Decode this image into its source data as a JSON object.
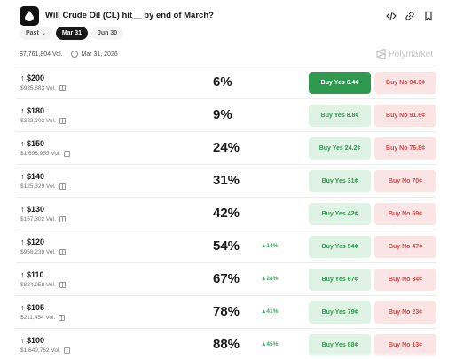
{
  "header": {
    "title": "Will Crude Oil (CL) hit__ by end of March?",
    "icons": [
      "drop-icon",
      "code-icon",
      "link-icon",
      "bookmark-icon"
    ]
  },
  "tabs": [
    {
      "label": "Past",
      "active": false,
      "has_caret": true
    },
    {
      "label": "Mar 31",
      "active": true
    },
    {
      "label": "Jun 30",
      "active": false
    }
  ],
  "meta": {
    "volume": "$7,761,804 Vol.",
    "date": "Mar 31, 2026"
  },
  "brand": "Polymarket",
  "colors": {
    "yes_bg": "#dff3e5",
    "yes_text": "#2f9a4f",
    "yes_solid": "#2f9a4f",
    "no_bg": "#fbe4e4",
    "no_text": "#d24a4a",
    "change_up": "#3bab5f"
  },
  "markets": [
    {
      "price": "↑ $200",
      "volume": "$935,883 Vol.",
      "percent": "6%",
      "change": "",
      "buy_yes": "Buy Yes 6.4¢",
      "buy_no": "Buy No 94.0¢",
      "yes_highlighted": true
    },
    {
      "price": "↑ $180",
      "volume": "$323,203 Vol.",
      "percent": "9%",
      "change": "",
      "buy_yes": "Buy Yes 8.8¢",
      "buy_no": "Buy No 91.6¢"
    },
    {
      "price": "↑ $150",
      "volume": "$1,698,955 Vol.",
      "percent": "24%",
      "change": "",
      "buy_yes": "Buy Yes 24.2¢",
      "buy_no": "Buy No 76.8¢"
    },
    {
      "price": "↑ $140",
      "volume": "$125,329 Vol.",
      "percent": "31%",
      "change": "",
      "buy_yes": "Buy Yes 31¢",
      "buy_no": "Buy No 70¢"
    },
    {
      "price": "↑ $130",
      "volume": "$157,302 Vol.",
      "percent": "42%",
      "change": "",
      "buy_yes": "Buy Yes 42¢",
      "buy_no": "Buy No 59¢"
    },
    {
      "price": "↑ $120",
      "volume": "$958,239 Vol.",
      "percent": "54%",
      "change": "▲14%",
      "buy_yes": "Buy Yes 54¢",
      "buy_no": "Buy No 47¢"
    },
    {
      "price": "↑ $110",
      "volume": "$824,958 Vol.",
      "percent": "67%",
      "change": "▲28%",
      "buy_yes": "Buy Yes 67¢",
      "buy_no": "Buy No 34¢"
    },
    {
      "price": "↑ $105",
      "volume": "$211,454 Vol.",
      "percent": "78%",
      "change": "▲41%",
      "buy_yes": "Buy Yes 79¢",
      "buy_no": "Buy No 23¢"
    },
    {
      "price": "↑ $100",
      "volume": "$1,640,762 Vol.",
      "percent": "88%",
      "change": "▲45%",
      "buy_yes": "Buy Yes 88¢",
      "buy_no": "Buy No 13¢"
    }
  ]
}
